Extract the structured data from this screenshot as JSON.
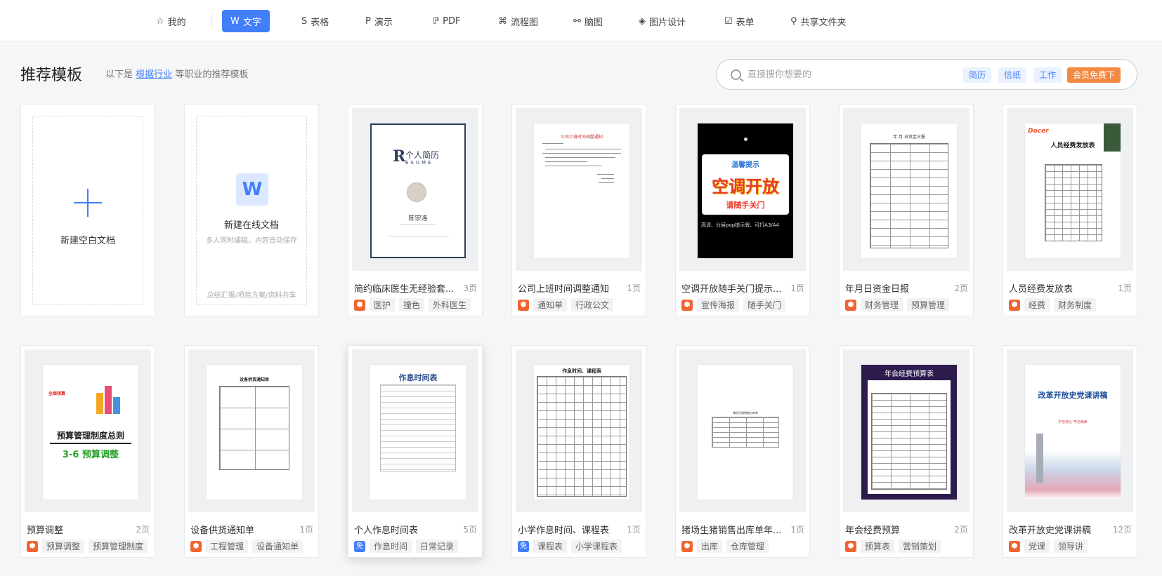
{
  "nav": {
    "items": [
      {
        "label": "我的",
        "icon": "star-icon"
      },
      {
        "label": "文字",
        "icon": "w-doc-icon",
        "active": true
      },
      {
        "label": "表格",
        "icon": "s-sheet-icon"
      },
      {
        "label": "演示",
        "icon": "p-slides-icon"
      },
      {
        "label": "PDF",
        "icon": "pdf-icon"
      },
      {
        "label": "流程图",
        "icon": "flowchart-icon"
      },
      {
        "label": "脑图",
        "icon": "mindmap-icon"
      },
      {
        "label": "图片设计",
        "icon": "image-design-icon"
      },
      {
        "label": "表单",
        "icon": "form-icon"
      },
      {
        "label": "共享文件夹",
        "icon": "share-folder-icon"
      }
    ]
  },
  "header": {
    "title": "推荐模板",
    "subtitle_prefix": "以下是",
    "subtitle_link": "根据行业",
    "subtitle_suffix": "等职业的推荐模板"
  },
  "search": {
    "placeholder": "直接搜你想要的",
    "hot_tags": [
      "简历",
      "信纸",
      "工作"
    ],
    "vip_tag": "会员免费下"
  },
  "new_blank": {
    "label": "新建空白文档"
  },
  "new_online": {
    "label": "新建在线文档",
    "sub": "多人同时编辑，内容自动保存",
    "footer": "总结汇报/项目方案/资料共享"
  },
  "templates": [
    {
      "title": "简约临床医生无经验套...",
      "pages": "3页",
      "badge": "orange",
      "tags": [
        "医护",
        "撞色",
        "外科医生"
      ],
      "thumb": {
        "resume_title": "个人简历",
        "resume_en": "ESUME",
        "resume_initial": "R",
        "name": "陈宗洛"
      }
    },
    {
      "title": "公司上班时间调整通知",
      "pages": "1页",
      "badge": "orange",
      "tags": [
        "通知单",
        "行政公文"
      ],
      "thumb": {
        "heading": "公司上班时间调整通知"
      }
    },
    {
      "title": "空调开放随手关门提示...",
      "pages": "1页",
      "badge": "orange",
      "tags": [
        "宣传海报",
        "随手关门"
      ],
      "thumb": {
        "sign_top": "温馨提示",
        "sign_main": "空调开放",
        "sign_bottom": "请随手关门",
        "caption": "高清、分层pop提示牌、可打A3/A4"
      }
    },
    {
      "title": "年月日资金日报",
      "pages": "2页",
      "badge": "orange",
      "tags": [
        "财务管理",
        "预算管理"
      ],
      "thumb": {
        "heading": "年 月 日资金日报"
      }
    },
    {
      "title": "人员经费发放表",
      "pages": "1页",
      "badge": "orange",
      "tags": [
        "经费",
        "财务制度"
      ],
      "thumb": {
        "heading": "人员经费发放表",
        "logo": "Docer"
      }
    },
    {
      "title": "预算调整",
      "pages": "2页",
      "badge": "orange",
      "tags": [
        "预算调整",
        "预算管理制度"
      ],
      "thumb": {
        "badge_text": "全面预算",
        "main": "预算管理制度总则",
        "sub": "3-6  预算调整"
      }
    },
    {
      "title": "设备供货通知单",
      "pages": "1页",
      "badge": "orange",
      "tags": [
        "工程管理",
        "设备通知单"
      ],
      "thumb": {
        "heading": "设备供货通知单"
      }
    },
    {
      "title": "个人作息时间表",
      "pages": "5页",
      "badge": "blue",
      "tags": [
        "作息时间",
        "日常记录"
      ],
      "thumb": {
        "heading": "作息时间表"
      }
    },
    {
      "title": "小学作息时间、课程表",
      "pages": "1页",
      "badge": "blue",
      "tags": [
        "课程表",
        "小学课程表"
      ],
      "thumb": {
        "heading": "作息时间、课程表"
      }
    },
    {
      "title": "猪场生猪销售出库单年...",
      "pages": "1页",
      "badge": "orange",
      "tags": [
        "出库",
        "仓库管理"
      ],
      "thumb": {
        "heading": "猪场生猪销售出库单"
      }
    },
    {
      "title": "年会经费预算",
      "pages": "2页",
      "badge": "orange",
      "tags": [
        "预算表",
        "营销策划"
      ],
      "thumb": {
        "heading": "年会经费预算表"
      }
    },
    {
      "title": "改革开放史党课讲稿",
      "pages": "12页",
      "badge": "orange",
      "tags": [
        "党课",
        "领导讲"
      ],
      "thumb": {
        "heading": "改革开放史党课讲稿",
        "sub": "不忘初心 牢记使命"
      }
    }
  ],
  "badges": {
    "free_glyph_orange": "⬢",
    "free_glyph_blue": "免"
  },
  "colors": {
    "accent": "#417ff9",
    "vip": "#f38a44",
    "free_badge": "#f0652f"
  }
}
